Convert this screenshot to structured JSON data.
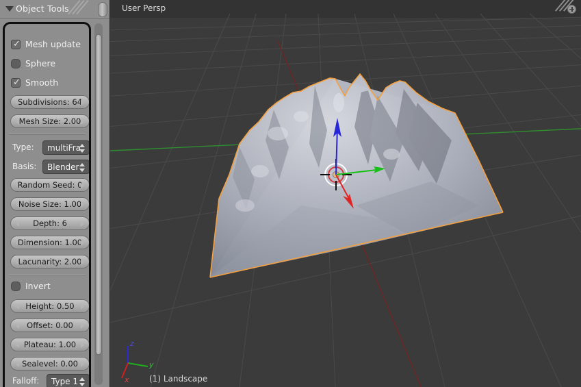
{
  "panel": {
    "title": "Object Tools",
    "collapse_icon": "triangle-down-icon",
    "checkboxes": [
      {
        "label": "Mesh update",
        "checked": true,
        "name": "mesh-update"
      },
      {
        "label": "Sphere",
        "checked": false,
        "name": "sphere"
      },
      {
        "label": "Smooth",
        "checked": true,
        "name": "smooth"
      }
    ],
    "sliders_top": [
      {
        "label": "Subdivisions: 64",
        "name": "subdivisions"
      },
      {
        "label": "Mesh Size: 2.00",
        "name": "mesh-size"
      }
    ],
    "dropdowns": [
      {
        "label": "Type:",
        "value": "multiFra",
        "name": "type"
      },
      {
        "label": "Basis:",
        "value": "Blender",
        "name": "basis"
      }
    ],
    "sliders_noise": [
      {
        "label": "Random Seed: 0",
        "name": "random-seed"
      },
      {
        "label": "Noise Size: 1.00",
        "name": "noise-size"
      },
      {
        "label": "Depth: 6",
        "name": "depth"
      },
      {
        "label": "Dimension: 1.00",
        "name": "dimension"
      },
      {
        "label": "Lacunarity: 2.00",
        "name": "lacunarity"
      }
    ],
    "invert": {
      "label": "Invert",
      "checked": false,
      "name": "invert"
    },
    "sliders_height": [
      {
        "label": "Height: 0.50",
        "name": "height"
      },
      {
        "label": "Offset: 0.00",
        "name": "offset"
      },
      {
        "label": "Plateau: 1.00",
        "name": "plateau"
      },
      {
        "label": "Sealevel: 0.00",
        "name": "sealevel"
      }
    ],
    "falloff": {
      "label": "Falloff:",
      "value": "Type 1",
      "name": "falloff"
    }
  },
  "viewport": {
    "header_text": "User Persp",
    "object_name": "(1) Landscape",
    "gear_icon": "settings-plus-icon",
    "axis_gizmo": {
      "x": "x",
      "y": "y",
      "z": "z"
    }
  },
  "colors": {
    "panel_bg": "#8e8e8e",
    "viewport_bg": "#3b3b3b",
    "grid_line": "#4b4b4b",
    "axis_x": "#6e2626",
    "axis_y": "#2f8a2f",
    "selection_outline": "#f29b38",
    "manip_x": "#e02020",
    "manip_y": "#18c018",
    "manip_z": "#2a2ae0",
    "terrain_light": "#c3c5ce",
    "terrain_dark": "#6f7380",
    "text_light": "#f0f0f0"
  }
}
